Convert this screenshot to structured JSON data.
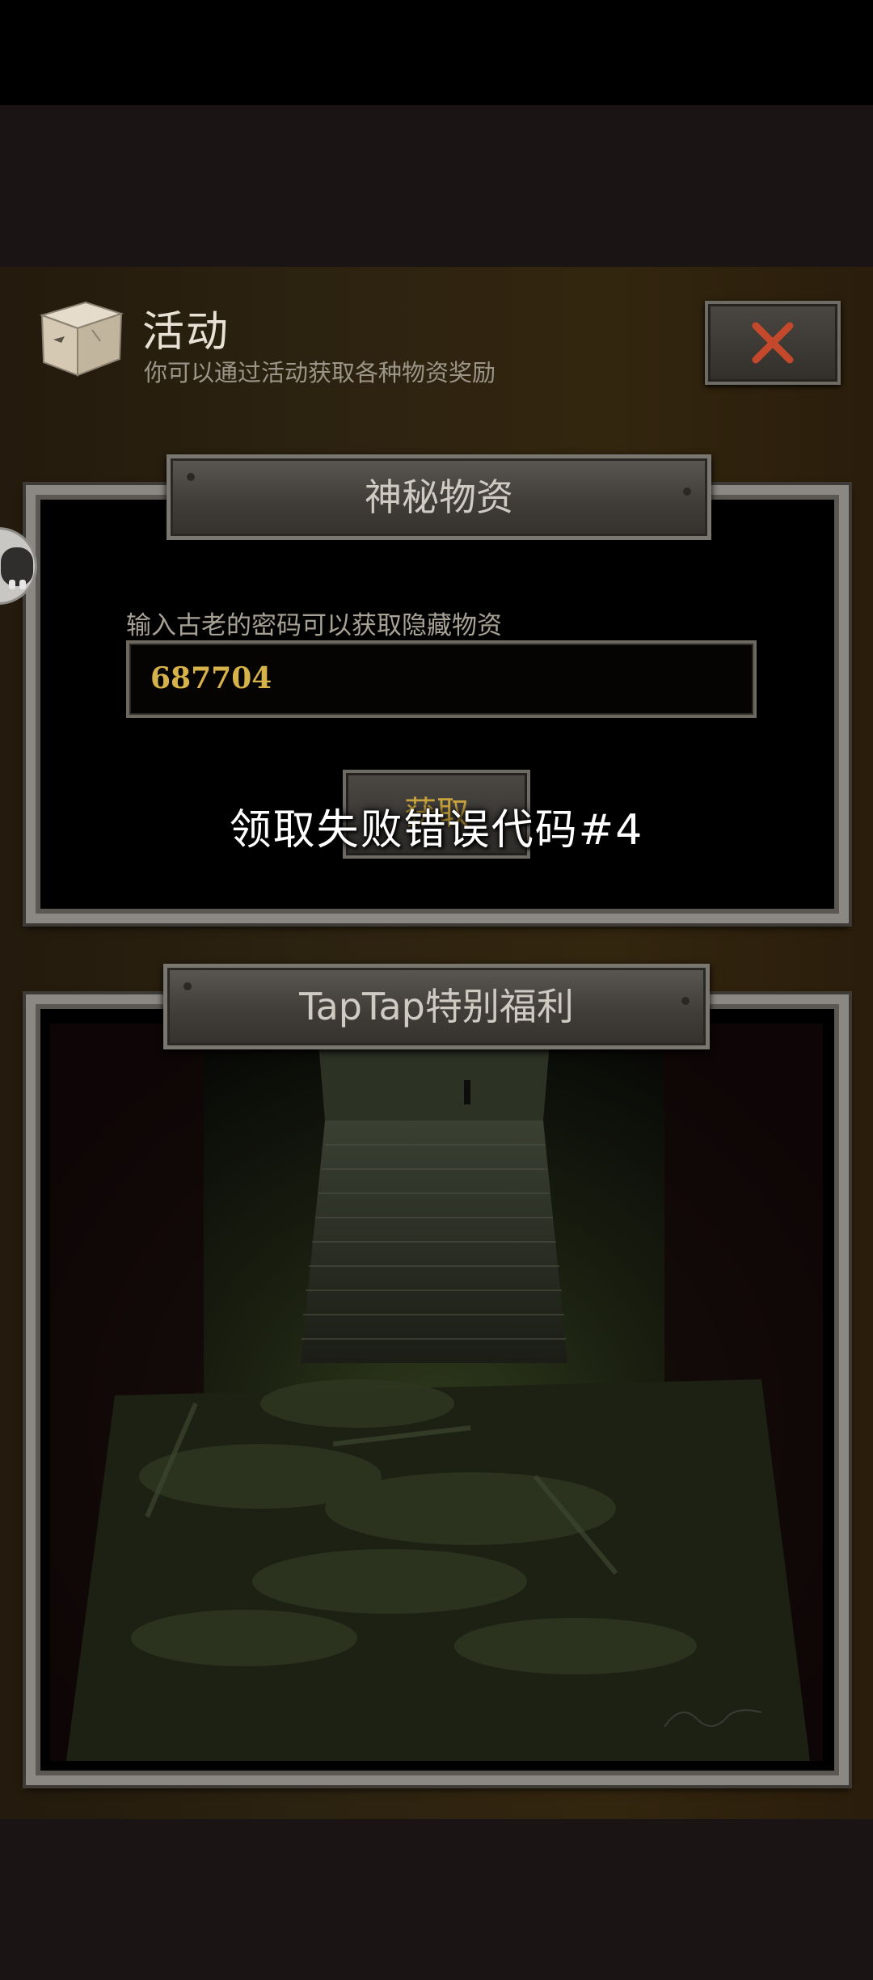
{
  "header": {
    "title": "活动",
    "subtitle": "你可以通过活动获取各种物资奖励",
    "box_icon": "cardboard-box-icon",
    "close_icon": "close-x-icon"
  },
  "secret_supplies": {
    "title": "神秘物资",
    "prompt": "输入古老的密码可以获取隐藏物资",
    "code_value": "687704",
    "claim_label": "获取"
  },
  "toast": {
    "message": "领取失败错误代码#4"
  },
  "taptap": {
    "title": "TapTap特别福利"
  },
  "colors": {
    "close_x": "#c4482b",
    "code_text": "#d6b24a",
    "claim_text": "#c9a43e"
  }
}
